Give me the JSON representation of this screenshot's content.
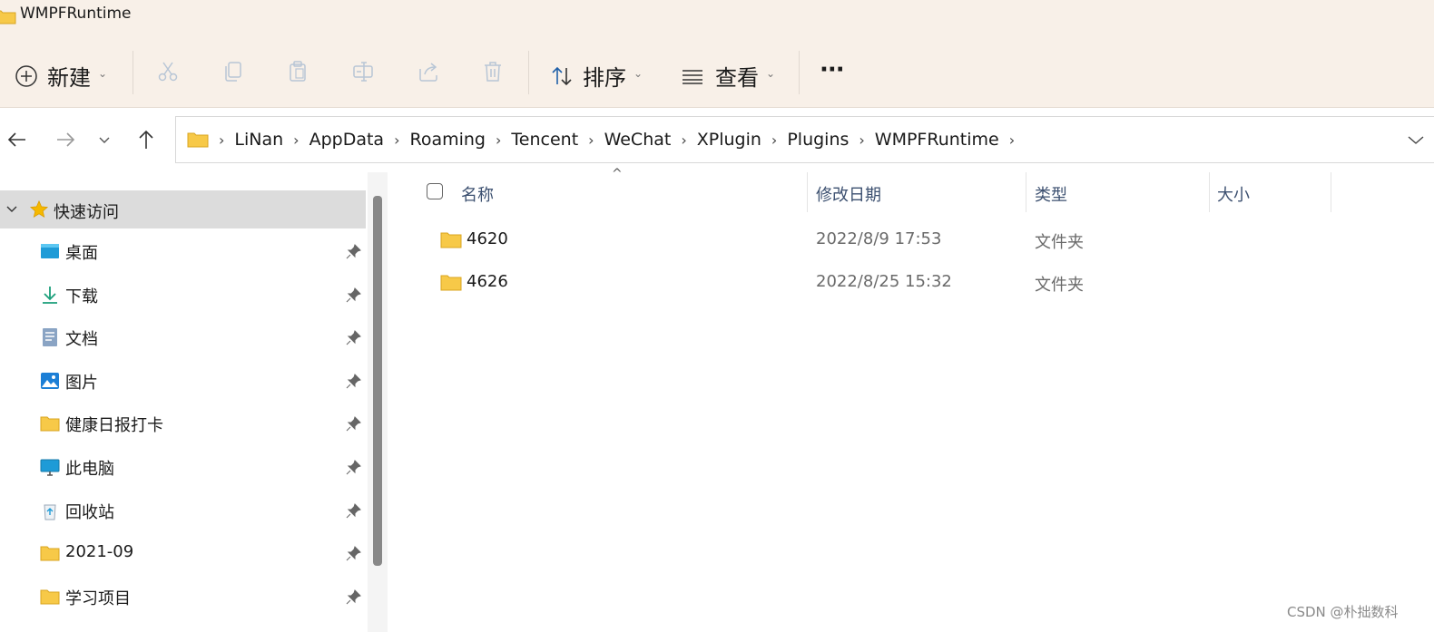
{
  "window": {
    "title": "WMPFRuntime"
  },
  "toolbar": {
    "new_label": "新建",
    "sort_label": "排序",
    "view_label": "查看",
    "more_label": "···"
  },
  "address": {
    "crumbs": [
      "LiNan",
      "AppData",
      "Roaming",
      "Tencent",
      "WeChat",
      "XPlugin",
      "Plugins",
      "WMPFRuntime"
    ]
  },
  "sidebar": {
    "quick_access": "快速访问",
    "items": [
      {
        "label": "桌面",
        "icon": "desktop-icon"
      },
      {
        "label": "下载",
        "icon": "download-icon"
      },
      {
        "label": "文档",
        "icon": "document-icon"
      },
      {
        "label": "图片",
        "icon": "pictures-icon"
      },
      {
        "label": "健康日报打卡",
        "icon": "folder-icon"
      },
      {
        "label": "此电脑",
        "icon": "computer-icon"
      },
      {
        "label": "回收站",
        "icon": "recycle-bin-icon"
      },
      {
        "label": "2021-09",
        "icon": "folder-icon"
      },
      {
        "label": "学习项目",
        "icon": "folder-icon"
      }
    ]
  },
  "columns": {
    "name": "名称",
    "date": "修改日期",
    "type": "类型",
    "size": "大小"
  },
  "files": [
    {
      "name": "4620",
      "date": "2022/8/9 17:53",
      "type": "文件夹"
    },
    {
      "name": "4626",
      "date": "2022/8/25 15:32",
      "type": "文件夹"
    }
  ],
  "watermark": "CSDN @朴拙数科",
  "colors": {
    "chrome_bg": "#f8f0e8",
    "folder": "#f7c948",
    "selected": "#dcdcdc"
  }
}
